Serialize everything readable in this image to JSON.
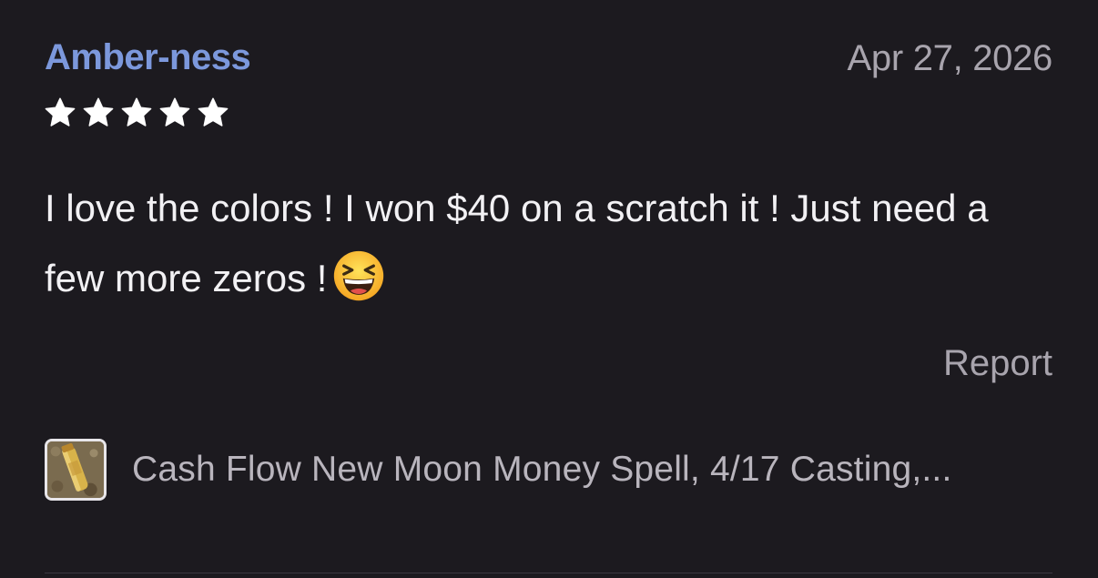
{
  "review": {
    "reviewer_name": "Amber-ness",
    "date": "Apr 27, 2026",
    "rating": 5,
    "rating_max": 5,
    "text": "I love the colors ! I won $40 on a scratch it ! Just need a few more zeros !",
    "emoji": "grinning-squinting-face",
    "report_label": "Report"
  },
  "product": {
    "title": "Cash Flow New Moon Money Spell, 4/17 Casting,...",
    "thumbnail_icon": "product-thumbnail"
  },
  "colors": {
    "background": "#1c1a1f",
    "reviewer_name": "#7c98dc",
    "secondary_text": "#a8a4ad",
    "primary_text": "#f2f1f4",
    "star": "#ffffff"
  }
}
